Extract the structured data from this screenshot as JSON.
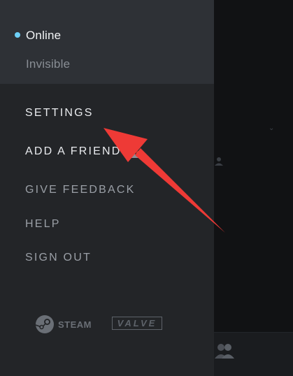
{
  "status_menu": {
    "online_label": "Online",
    "invisible_label": "Invisible"
  },
  "menu": {
    "settings_label": "SETTINGS",
    "add_friend_label": "ADD A FRIEND",
    "give_feedback_label": "GIVE FEEDBACK",
    "help_label": "HELP",
    "sign_out_label": "SIGN OUT"
  },
  "logos": {
    "steam": "STEAM",
    "valve": "VALVE"
  },
  "icons": {
    "online_status": "status-dot-icon",
    "add_friend": "add-friend-icon",
    "steam_logo": "steam-logo-icon",
    "arrow": "annotation-arrow"
  },
  "colors": {
    "online": "#6dcff6",
    "badge": "#d9452e",
    "arrow": "#ee3a36"
  }
}
